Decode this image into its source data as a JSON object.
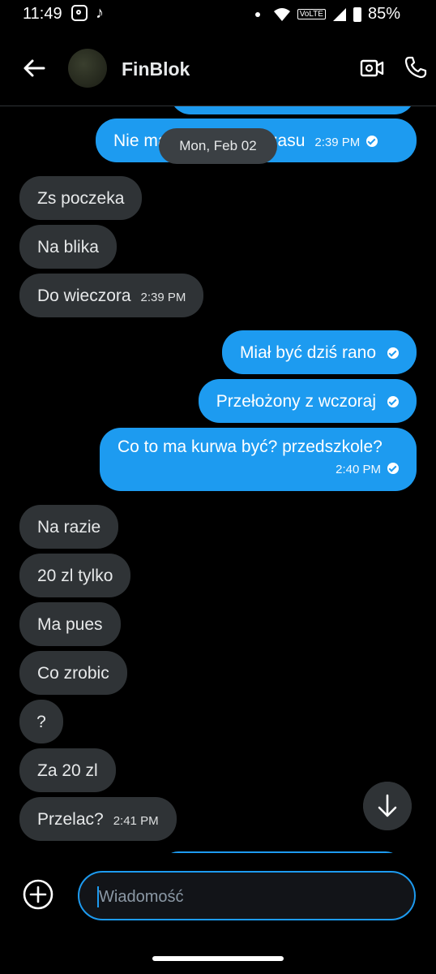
{
  "status_bar": {
    "time": "11:49",
    "battery": "85%",
    "network": "VoLTE"
  },
  "header": {
    "title": "FinBlok"
  },
  "date_separator": "Mon, Feb 02",
  "messages": [
    {
      "dir": "out",
      "text": "Nie ma",
      "text_end": "czasu",
      "time": "2:39 PM",
      "seen": true
    },
    {
      "dir": "in",
      "text": "Zs poczeka"
    },
    {
      "dir": "in",
      "text": "Na blika"
    },
    {
      "dir": "in",
      "text": "Do wieczora",
      "time": "2:39 PM"
    },
    {
      "dir": "out",
      "text": "Miał być dziś rano",
      "seen": true
    },
    {
      "dir": "out",
      "text": "Przełożony z wczoraj",
      "seen": true
    },
    {
      "dir": "out",
      "text": "Co to ma kurwa być? przedszkole?",
      "time": "2:40 PM",
      "seen": true
    },
    {
      "dir": "in",
      "text": "Na razie"
    },
    {
      "dir": "in",
      "text": "20 zl tylko"
    },
    {
      "dir": "in",
      "text": "Ma pues"
    },
    {
      "dir": "in",
      "text": "Co zrobic"
    },
    {
      "dir": "in",
      "text": "?"
    },
    {
      "dir": "in",
      "text": "Za 20 zl"
    },
    {
      "dir": "in",
      "text": "Przelac?",
      "time": "2:41 PM"
    }
  ],
  "composer": {
    "placeholder": "Wiadomość"
  },
  "colors": {
    "accent": "#1d9bf0",
    "incoming_bubble": "#2f3336",
    "background": "#000000"
  }
}
